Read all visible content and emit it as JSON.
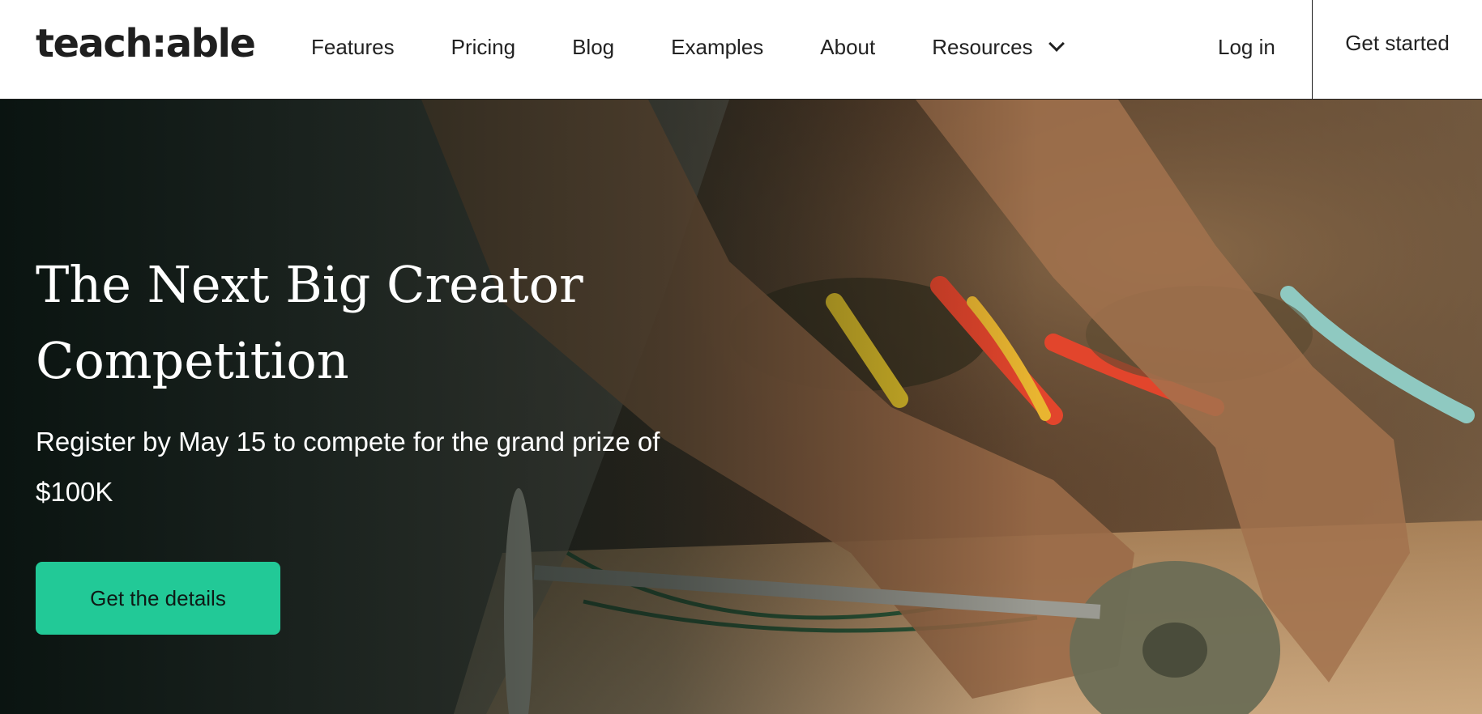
{
  "header": {
    "logo_text": "teach:able",
    "nav": [
      {
        "label": "Features"
      },
      {
        "label": "Pricing"
      },
      {
        "label": "Blog"
      },
      {
        "label": "Examples"
      },
      {
        "label": "About"
      },
      {
        "label": "Resources"
      }
    ],
    "login_label": "Log in",
    "get_started_label": "Get started"
  },
  "hero": {
    "title": "The Next Big Creator Competition",
    "subtitle": "Register by May 15 to compete for the grand prize of $100K",
    "cta_label": "Get the details"
  },
  "colors": {
    "accent": "#22c997",
    "text_dark": "#222222",
    "header_bg": "#ffffff"
  }
}
